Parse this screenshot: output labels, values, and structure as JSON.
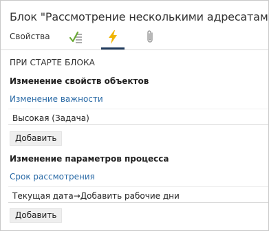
{
  "window": {
    "title": "Блок \"Рассмотрение несколькими адресатами\""
  },
  "tabs": [
    {
      "label": "Свойства",
      "icon": "properties"
    },
    {
      "label": "",
      "icon": "checklist-icon"
    },
    {
      "label": "",
      "icon": "lightning-icon"
    },
    {
      "label": "",
      "icon": "paperclip-icon"
    }
  ],
  "active_tab_index": 2,
  "colors": {
    "accent": "#1f3a5c",
    "link": "#2a6aa6",
    "lightning": "#f0b400",
    "checklist": "#6aaa35"
  },
  "main": {
    "section_title": "ПРИ СТАРТЕ БЛОКА",
    "groups": [
      {
        "title": "Изменение свойств объектов",
        "link": "Изменение важности",
        "value": "Высокая (Задача)",
        "button": "Добавить"
      },
      {
        "title": "Изменение параметров процесса",
        "link": "Срок рассмотрения",
        "value": "Текущая дата→Добавить рабочие дни",
        "button": "Добавить"
      }
    ]
  }
}
